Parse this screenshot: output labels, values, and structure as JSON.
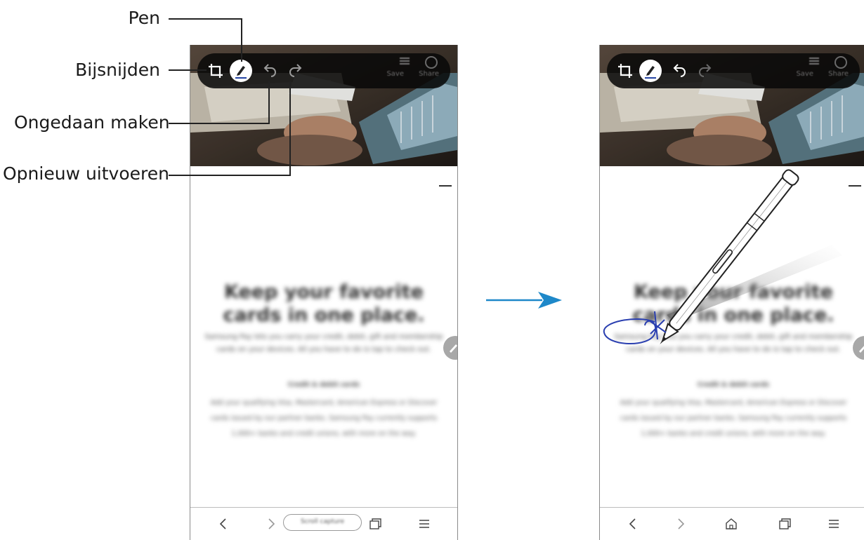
{
  "callouts": {
    "pen": "Pen",
    "crop": "Bijsnijden",
    "undo": "Ongedaan maken",
    "redo": "Opnieuw uitvoeren"
  },
  "toolbar": {
    "save": "Save",
    "share": "Share"
  },
  "content": {
    "headline": "Keep your favorite cards in one place.",
    "description": "Samsung Pay lets you carry your credit, debit, gift and membership cards on your devices. All you have to do is tap to check out.",
    "section_title": "Credit & debit cards",
    "section_body": "Add your qualifying Visa, Mastercard, American Express or Discover cards issued by our partner banks. Samsung Pay currently supports 1,000+ banks and credit unions, with more on the way."
  },
  "bottom_bar": {
    "scroll_capture": "Scroll capture"
  },
  "colors": {
    "toolbar_bg": "#141414",
    "arrow": "#1e88c9",
    "pen_accent": "#2f4da8",
    "scribble": "#2a3fb0",
    "fab": "#a8a8a8"
  },
  "icons": [
    "crop-icon",
    "pen-icon",
    "undo-icon",
    "redo-icon",
    "back-icon",
    "forward-icon",
    "home-icon",
    "tabs-icon",
    "menu-icon",
    "edit-icon"
  ]
}
